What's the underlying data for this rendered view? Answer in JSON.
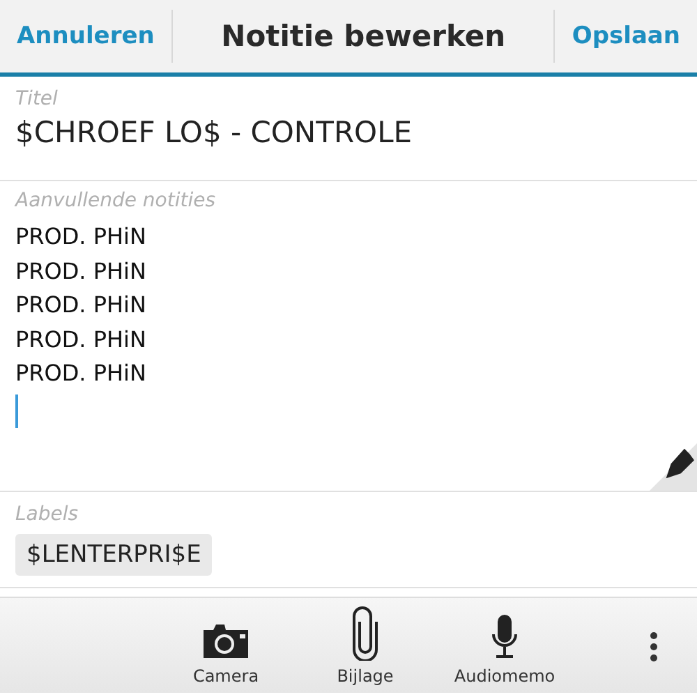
{
  "header": {
    "cancel": "Annuleren",
    "title": "Notitie bewerken",
    "save": "Opslaan"
  },
  "title_field": {
    "label": "Titel",
    "value": "$CHROEF LO$ - CONTROLE"
  },
  "notes_field": {
    "placeholder": "Aanvullende notities",
    "lines": [
      "PROD. PHiN",
      "PROD. PHiN",
      "PROD. PHiN",
      "PROD. PHiN",
      "PROD. PHiN"
    ]
  },
  "labels": {
    "label": "Labels",
    "tags": [
      "$LENTERPRI$E"
    ]
  },
  "action_bar": [
    {
      "kind": "camera",
      "label": "Camera"
    },
    {
      "kind": "attachment",
      "label": "Bijlage"
    },
    {
      "kind": "microphone",
      "label": "Audiomemo"
    }
  ]
}
